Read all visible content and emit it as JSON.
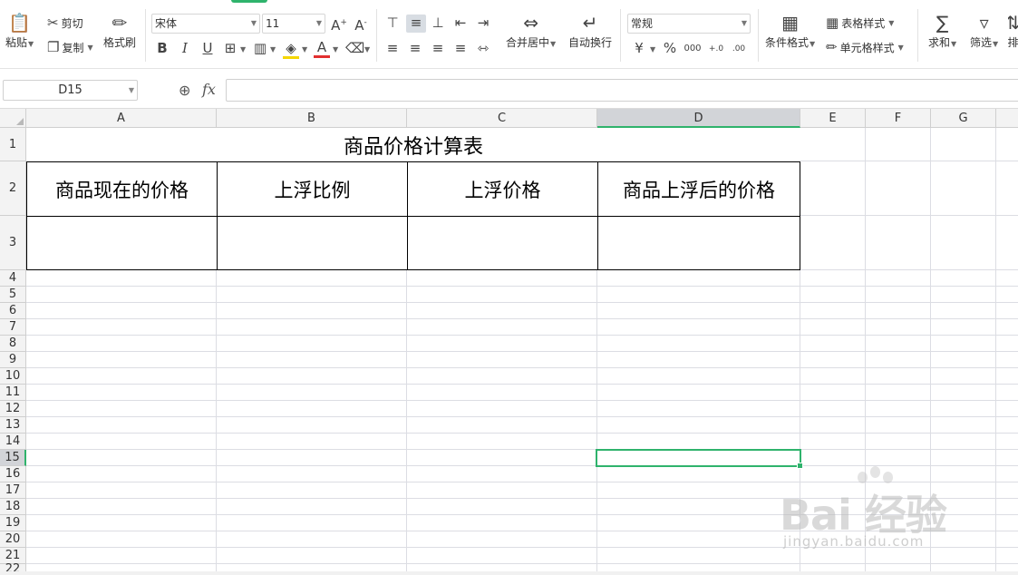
{
  "ribbon": {
    "paste": "粘贴",
    "cut": "剪切",
    "copy": "复制",
    "format_painter": "格式刷",
    "font_name": "宋体",
    "font_size": "11",
    "bold": "B",
    "italic": "I",
    "underline": "U",
    "merge_center": "合并居中",
    "wrap_text": "自动换行",
    "number_format": "常规",
    "currency": "¥",
    "percent": "%",
    "thousands": "000",
    "inc_decimal": "+.0",
    "dec_decimal": ".00",
    "conditional_format": "条件格式",
    "table_style": "表格样式",
    "cell_style": "单元格样式",
    "sum": "求和",
    "filter": "筛选",
    "sort_partial": "排"
  },
  "formula_bar": {
    "name_box": "D15",
    "fx_label": "fx",
    "formula": ""
  },
  "sheet": {
    "columns": [
      "A",
      "B",
      "C",
      "D",
      "E",
      "F",
      "G"
    ],
    "selected_column": "D",
    "rows": [
      "1",
      "2",
      "3",
      "4",
      "5",
      "6",
      "7",
      "8",
      "9",
      "10",
      "11",
      "12",
      "13",
      "14",
      "15",
      "16",
      "17",
      "18",
      "19",
      "20",
      "21",
      "22"
    ],
    "selected_row": "15",
    "table": {
      "title": "商品价格计算表",
      "headers": [
        "商品现在的价格",
        "上浮比例",
        "上浮价格",
        "商品上浮后的价格"
      ],
      "row3": [
        "",
        "",
        "",
        ""
      ]
    }
  },
  "watermark": {
    "logo": "Bai 经验",
    "url": "jingyan.baidu.com"
  },
  "colors": {
    "accent": "#2fb36c",
    "header_bg": "#f3f3f3",
    "selected_header_bg": "#d2d4d8",
    "gridline": "#dcdde3"
  }
}
